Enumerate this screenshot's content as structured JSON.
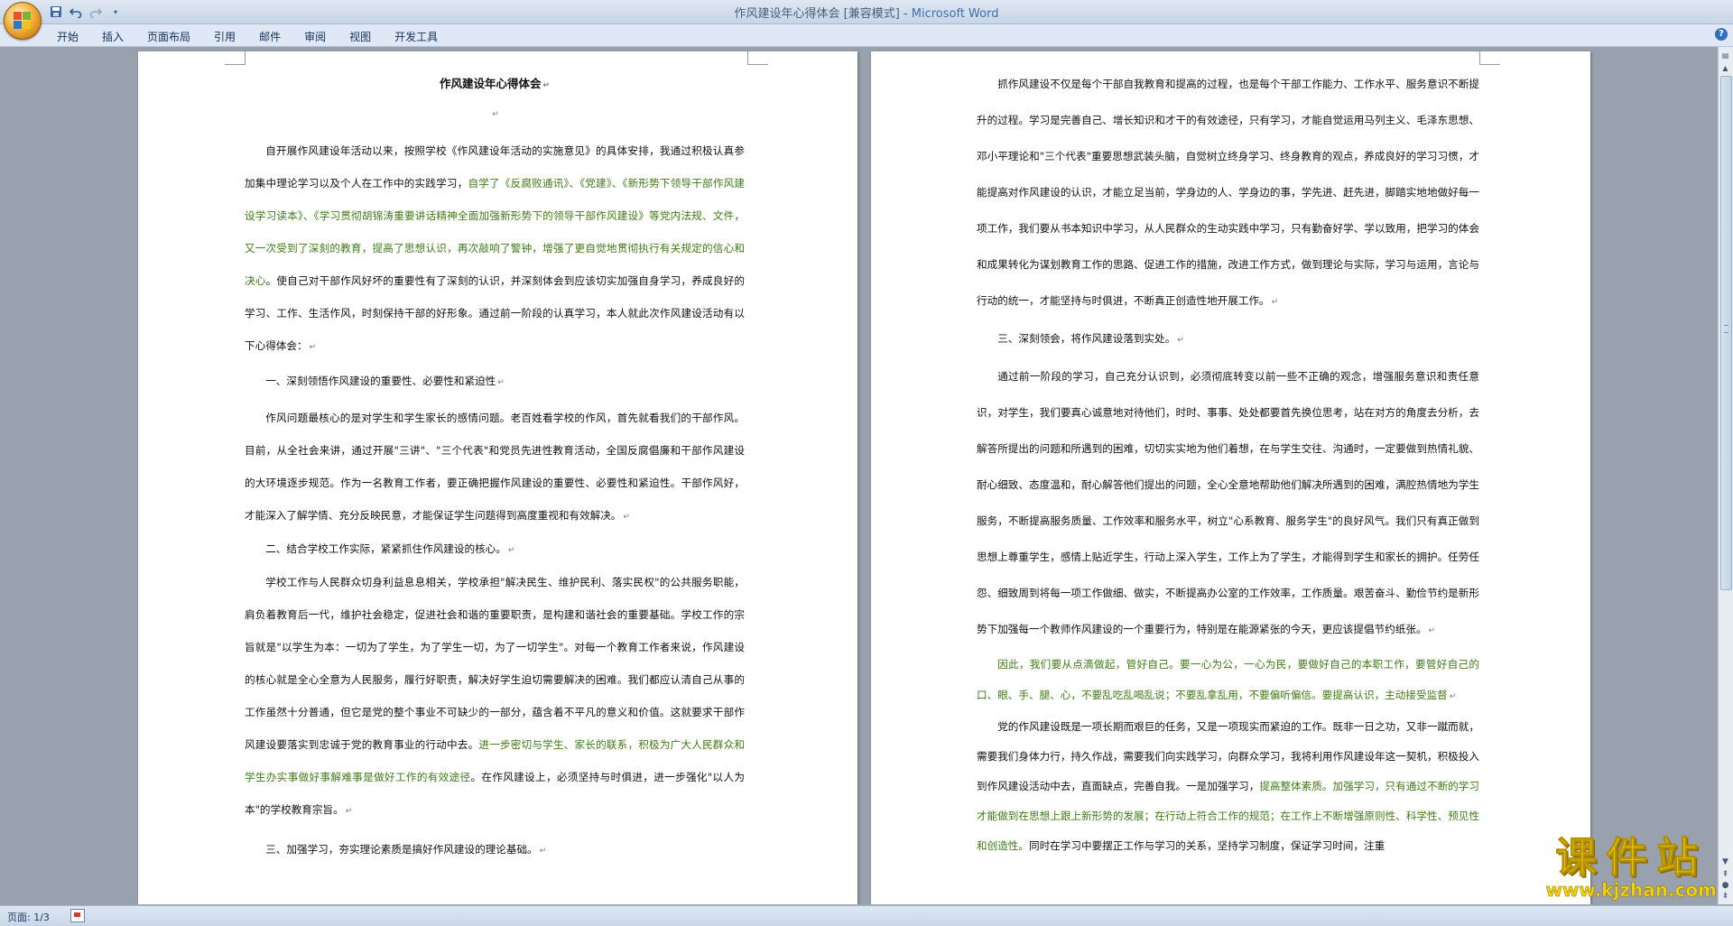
{
  "window": {
    "title_doc": "作风建设年心得体会 [兼容模式] - ",
    "title_app": "Microsoft Word"
  },
  "quick_access": {
    "save_icon": "save-icon",
    "undo_icon": "undo-icon",
    "redo_icon": "redo-icon",
    "more_icon": "chevron-down-icon"
  },
  "ribbon": {
    "tabs": [
      "开始",
      "插入",
      "页面布局",
      "引用",
      "邮件",
      "审阅",
      "视图",
      "开发工具"
    ]
  },
  "doc": {
    "title": "作风建设年心得体会",
    "page1": {
      "p1_a": "自开展作风建设年活动以来，按照学校《作风建设年活动的实施意见》的具体安排，我通过积极认真参加集中理论学习以及个人在工作中的实践学习，",
      "p1_b": "自学了《反腐败通讯》、《党建》、《新形势下领导干部作风建设学习读本》、《学习贯彻胡锦涛重要讲话精神全面加强新形势下的领导干部作风建设》等党内法规、文件，又一次受到了深刻的教育，提高了思想认识，再次敲响了警钟，增强了更自觉地贯彻执行有关规定的信心和决心",
      "p1_c": "。使自己对干部作风好坏的重要性有了深刻的认识，并深刻体会到应该切实加强自身学习，养成良好的学习、工作、生活作风，时刻保持干部的好形象。通过前一阶段的认真学习，本人就此次作风建设活动有以下心得体会：",
      "h1": "一、深刻领悟作风建设的重要性、必要性和紧迫性",
      "p2": "作风问题最核心的是对学生和学生家长的感情问题。老百姓看学校的作风，首先就看我们的干部作风。目前，从全社会来讲，通过开展\"三讲\"、\"三个代表\"和党员先进性教育活动，全国反腐倡廉和干部作风建设的大环境逐步规范。作为一名教育工作者，要正确把握作风建设的重要性、必要性和紧迫性。干部作风好，才能深入了解学情、充分反映民意，才能保证学生问题得到高度重视和有效解决。",
      "h2": "二、结合学校工作实际，紧紧抓住作风建设的核心。",
      "p3_a": "学校工作与人民群众切身利益息息相关，学校承担\"解决民生、维护民利、落实民权\"的公共服务职能，肩负着教育后一代，维护社会稳定，促进社会和谐的重要职责，是构建和谐社会的重要基础。学校工作的宗旨就是\"以学生为本：一切为了学生，为了学生一切，为了一切学生\"。对每一个教育工作者来说，作风建设的核心就是全心全意为人民服务，履行好职责，解决好学生迫切需要解决的困难。我们都应认清自己从事的工作虽然十分普通，但它是党的整个事业不可缺少的一部分，蕴含着不平凡的意义和价值。这就要求干部作风建设要落实到忠诚于党的教育事业的行动中去。",
      "p3_b": "进一步密切与学生、家长的联系，积极为广大人民群众和学生办实事做好事解难事是做好工作的有效途径",
      "p3_c": "。在作风建设上，必须坚持与时俱进，进一步强化\"以人为本\"的学校教育宗旨。",
      "h3": "三、加强学习，夯实理论素质是搞好作风建设的理论基础。"
    },
    "page2": {
      "p1": "抓作风建设不仅是每个干部自我教育和提高的过程，也是每个干部工作能力、工作水平、服务意识不断提升的过程。学习是完善自己、增长知识和才干的有效途径，只有学习，才能自觉运用马列主义、毛泽东思想、邓小平理论和\"三个代表\"重要思想武装头脑，自觉树立终身学习、终身教育的观点，养成良好的学习习惯，才能提高对作风建设的认识，才能立足当前，学身边的人、学身边的事，学先进、赶先进，脚踏实地地做好每一项工作，我们要从书本知识中学习，从人民群众的生动实践中学习，只有勤奋好学、学以致用，把学习的体会和成果转化为谋划教育工作的思路、促进工作的措施，改进工作方式，做到理论与实际，学习与运用，言论与行动的统一，才能坚持与时俱进，不断真正创造性地开展工作。",
      "h1": "三、深刻领会，将作风建设落到实处。",
      "p2": "通过前一阶段的学习，自己充分认识到，必须彻底转变以前一些不正确的观念，增强服务意识和责任意识，对学生，我们要真心诚意地对待他们，时时、事事、处处都要首先换位思考，站在对方的角度去分析，去解答所提出的问题和所遇到的困难，切切实实地为他们着想，在与学生交往、沟通时，一定要做到热情礼貌、耐心细致、态度温和，耐心解答他们提出的问题，全心全意地帮助他们解决所遇到的困难，满腔热情地为学生服务，不断提高服务质量、工作效率和服务水平，树立\"心系教育、服务学生\"的良好风气。我们只有真正做到思想上尊重学生，感情上贴近学生，行动上深入学生，工作上为了学生，才能得到学生和家长的拥护。任劳任怨、细致周到将每一项工作做细、做实，不断提高办公室的工作效率，工作质量。艰苦奋斗、勤俭节约是新形势下加强每一个教师作风建设的一个重要行为，特别是在能源紧张的今天，更应该提倡节约纸张。",
      "p3": "因此，我们要从点滴做起，管好自己。要一心为公，一心为民，要做好自己的本职工作，要管好自己的口、眼、手、腿、心，不要乱吃乱喝乱说；不要乱拿乱用，不要偏听偏信。要提高认识，主动接受监督",
      "p4_a": "党的作风建设既是一项长期而艰巨的任务，又是一项现实而紧迫的工作。既非一日之功，又非一蹴而就，需要我们身体力行，持久作战，需要我们向实践学习，向群众学习，我将利用作风建设年这一契机，积极投入到作风建设活动中去，直面缺点，完善自我。一是加强学习，",
      "p4_b": "提高整体素质。加强学习，只有通过不断的学习才能做到在思想上跟上新形势的发展；在行动上符合工作的规范；在工作上不断增强原则性、科学性、预见性和创造性。",
      "p4_c": "同时在学习中要摆正工作与学习的关系，坚持学习制度，保证学习时间，注重"
    }
  },
  "paragraph_mark": "↵",
  "status": {
    "page_counter": "页面: 1/3"
  },
  "watermark": {
    "text_cn": "课件站",
    "url": "www.kjzhan.com"
  }
}
